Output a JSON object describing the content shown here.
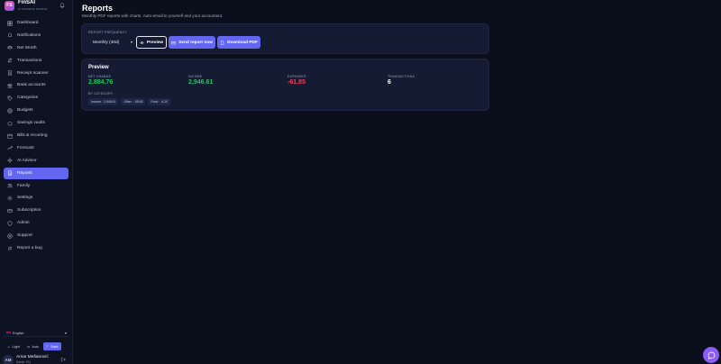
{
  "brand": {
    "logo_text": "FS",
    "name": "FinSAI",
    "subtitle": "AI FINANCE PORTAL"
  },
  "sidebar": {
    "items": [
      {
        "label": "Dashboard",
        "icon": "dashboard-icon"
      },
      {
        "label": "Notifications",
        "icon": "bell-icon"
      },
      {
        "label": "Net Worth",
        "icon": "scale-icon"
      },
      {
        "label": "Transactions",
        "icon": "swap-icon"
      },
      {
        "label": "Receipt scanner",
        "icon": "receipt-icon"
      },
      {
        "label": "Bank accounts",
        "icon": "bank-icon"
      },
      {
        "label": "Categories",
        "icon": "tag-icon"
      },
      {
        "label": "Budgets",
        "icon": "target-icon"
      },
      {
        "label": "Savings vaults",
        "icon": "piggy-icon"
      },
      {
        "label": "Bills & recurring",
        "icon": "calendar-icon"
      },
      {
        "label": "Forecast",
        "icon": "trend-icon"
      },
      {
        "label": "AI Advisor",
        "icon": "sparkle-icon"
      },
      {
        "label": "Reports",
        "icon": "document-icon",
        "active": true
      },
      {
        "label": "Family",
        "icon": "users-icon"
      },
      {
        "label": "Settings",
        "icon": "gear-icon"
      },
      {
        "label": "Subscription",
        "icon": "card-icon"
      },
      {
        "label": "Admin",
        "icon": "shield-icon"
      },
      {
        "label": "Support",
        "icon": "help-icon"
      },
      {
        "label": "Report a bug",
        "icon": "bug-icon"
      }
    ],
    "language": "English",
    "theme": {
      "light": "Light",
      "auto": "Auto",
      "dark": "Dark",
      "active": "Dark"
    },
    "user": {
      "initials": "AM",
      "name": "Amar Mešanović",
      "sub": "Admin ·EU"
    }
  },
  "page": {
    "title": "Reports",
    "subtitle": "Monthly PDF reports with charts. Auto-email to yourself and your accountant."
  },
  "controls": {
    "frequency_label": "REPORT FREQUENCY",
    "frequency_value": "Monthly (30d)",
    "preview_button": "Preview",
    "send_button": "Send report now",
    "download_button": "Download PDF"
  },
  "preview": {
    "title": "Preview",
    "metrics": [
      {
        "label": "NET CHANGE",
        "value": "2,884.76",
        "color": "green"
      },
      {
        "label": "INCOME",
        "value": "2,946.61",
        "color": "green"
      },
      {
        "label": "EXPENSES",
        "value": "-61.85",
        "color": "red"
      },
      {
        "label": "TRANSACTIONS",
        "value": "6",
        "color": "white"
      }
    ],
    "by_category_label": "BY CATEGORY",
    "categories": [
      "Income · 2,946.61",
      "Other · -55.65",
      "Food · -6.20"
    ]
  },
  "colors": {
    "accent": "#6366f1",
    "positive": "#22c55e",
    "negative": "#f43f5e",
    "fab": "#8b5cf6"
  }
}
